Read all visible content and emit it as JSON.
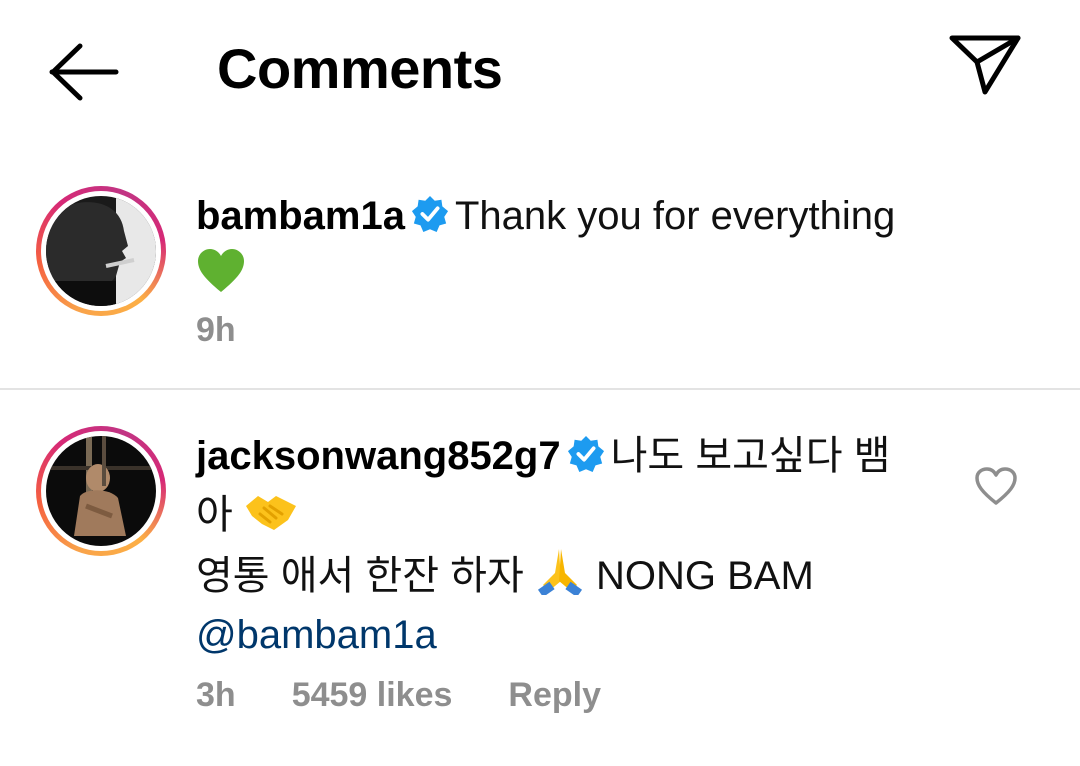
{
  "header": {
    "title": "Comments",
    "back_icon": "arrow-left-icon",
    "share_icon": "paper-plane-icon"
  },
  "comments": [
    {
      "username": "bambam1a",
      "verified": true,
      "text": "Thank you for everything",
      "emoji": "green-heart",
      "time": "9h"
    },
    {
      "username": "jacksonwang852g7",
      "verified": true,
      "text_line1": "나도 보고싶다 뱀",
      "text_line2": "아",
      "emoji1": "handshake",
      "text_line3": "영통 애서 한잔 하자",
      "emoji2": "folded-hands",
      "text_line3_tail": "NONG BAM",
      "mention": "@bambam1a",
      "time": "3h",
      "likes": "5459 likes",
      "reply_label": "Reply"
    }
  ],
  "colors": {
    "verified_badge": "#1d9bf0",
    "mention": "#00376b",
    "meta_gray": "#8e8e8e",
    "divider": "#e3e3e3"
  }
}
